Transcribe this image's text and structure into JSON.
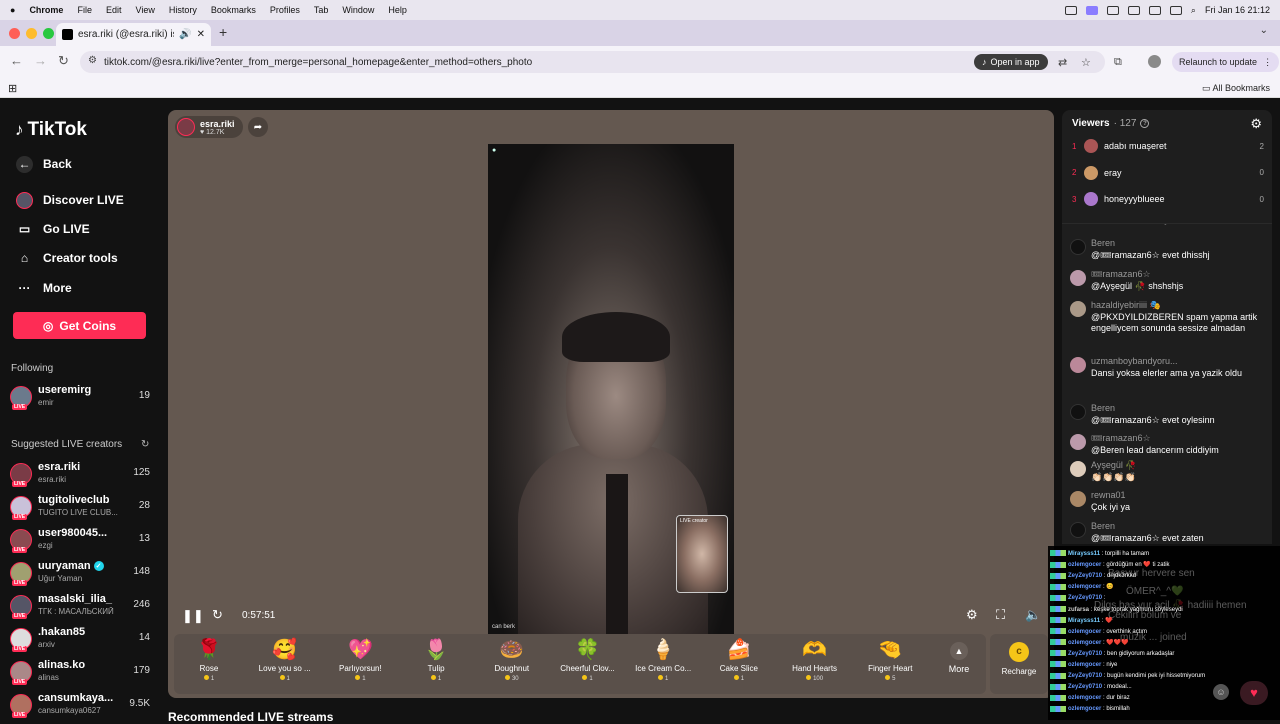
{
  "macbar": {
    "app": "Chrome",
    "menus": [
      "File",
      "Edit",
      "View",
      "History",
      "Bookmarks",
      "Profiles",
      "Tab",
      "Window",
      "Help"
    ],
    "clock": "Fri Jan 16  21:12"
  },
  "browser": {
    "tab_title": "esra.riki (@esra.riki) is LIVE",
    "url": "tiktok.com/@esra.riki/live?enter_from_merge=personal_homepage&enter_method=others_photo",
    "open_in_app": "Open in app",
    "relaunch": "Relaunch to update",
    "all_bookmarks": "All Bookmarks"
  },
  "sidebar": {
    "logo": "TikTok",
    "back": "Back",
    "discover": "Discover LIVE",
    "go_live": "Go LIVE",
    "creator_tools": "Creator tools",
    "more": "More",
    "get_coins": "Get Coins",
    "following_title": "Following",
    "following": [
      {
        "name": "useremirg",
        "sub": "emir",
        "count": "19",
        "color": "#6b7a8c"
      }
    ],
    "suggested_title": "Suggested LIVE creators",
    "suggested": [
      {
        "name": "esra.riki",
        "sub": "esra.riki",
        "count": "125",
        "color": "#7a3b46",
        "verified": false
      },
      {
        "name": "tugitoliveclub",
        "sub": "TUGITO LIVE CLUB...",
        "count": "28",
        "color": "#c9c1d9",
        "verified": false
      },
      {
        "name": "user980045...",
        "sub": "ezgi",
        "count": "13",
        "color": "#8a4a50",
        "verified": false
      },
      {
        "name": "uuryaman",
        "sub": "Uğur Yaman",
        "count": "148",
        "color": "#a0a070",
        "verified": true
      },
      {
        "name": "masalski_ilia_",
        "sub": "ТГК : МАСАЛЬСКИЙ",
        "count": "246",
        "color": "#556",
        "verified": false
      },
      {
        "name": ".hakan85",
        "sub": "arxiv",
        "count": "14",
        "color": "#ddd",
        "verified": false
      },
      {
        "name": "alinas.ko",
        "sub": "alinas",
        "count": "179",
        "color": "#a88",
        "verified": false
      },
      {
        "name": "cansumkaya...",
        "sub": "cansumkaya0627",
        "count": "9.5K",
        "color": "#b07060",
        "verified": false
      }
    ]
  },
  "stream": {
    "host_name": "esra.riki",
    "host_likes": "♥ 12.7K",
    "elapsed": "0:57:51",
    "video_corner": "",
    "video_caption": "can berk",
    "pip_label": "LIVE creator",
    "recommended": "Recommended LIVE streams"
  },
  "gifts": [
    {
      "name": "Rose",
      "price": "1",
      "icon": "🌹"
    },
    {
      "name": "Love you so ...",
      "price": "1",
      "icon": "🥰"
    },
    {
      "name": "Parlıyorsun!",
      "price": "1",
      "icon": "💖"
    },
    {
      "name": "Tulip",
      "price": "1",
      "icon": "🌷"
    },
    {
      "name": "Doughnut",
      "price": "30",
      "icon": "🍩"
    },
    {
      "name": "Cheerful Clov...",
      "price": "1",
      "icon": "🍀"
    },
    {
      "name": "Ice Cream Co...",
      "price": "1",
      "icon": "🍦"
    },
    {
      "name": "Cake Slice",
      "price": "1",
      "icon": "🍰"
    },
    {
      "name": "Hand Hearts",
      "price": "100",
      "icon": "🫶"
    },
    {
      "name": "Finger Heart",
      "price": "5",
      "icon": "🤏"
    }
  ],
  "gift_more": "More",
  "recharge": "Recharge",
  "viewers": {
    "title": "Viewers",
    "count": "· 127",
    "top": [
      {
        "rank": "1",
        "name": "adabı muaşeret",
        "score": "2",
        "color": "#a55"
      },
      {
        "rank": "2",
        "name": "eray",
        "score": "0",
        "color": "#c96"
      },
      {
        "rank": "3",
        "name": "honeyyyblueee",
        "score": "0",
        "color": "#a7c"
      }
    ]
  },
  "chat": [
    {
      "user": "Beren",
      "text": "@🎟ramazan6☆ evet dhisshj",
      "color": "#111"
    },
    {
      "user": "🎟ramazan6☆",
      "text": "@Ayşegül 🥀 shshshjs",
      "color": "#b9a"
    },
    {
      "user": "hazaldiyebiriiii 🎭",
      "text": "@PKXDYILDIZBEREN spam yapma artik engelliycem sonunda sessize almadan",
      "color": "#a98"
    },
    {
      "user": "uzmanboybandyoru...",
      "text": "Dansi yoksa elerler ama ya yazik oldu",
      "color": "#b89"
    },
    {
      "user": "Beren",
      "text": "@🎟ramazan6☆ evet oylesinn",
      "color": "#111"
    },
    {
      "user": "🎟ramazan6☆",
      "text": "@Beren lead dancerım ciddiyim",
      "color": "#b9a"
    },
    {
      "user": "Ayşegül 🥀",
      "text": "👏🏻👏🏻👏🏻👏🏻",
      "color": "#dcb"
    },
    {
      "user": "rewna01",
      "text": "Çok iyi ya",
      "color": "#a86"
    },
    {
      "user": "Beren",
      "text": "@🎟ramazan6☆ evet zaten",
      "color": "#111"
    }
  ],
  "overlay_lines": [
    {
      "user": "Miraysss11",
      "text": "torpilli ha tamam",
      "color": "#7cf"
    },
    {
      "user": "ozlemgocer",
      "text": "gördüğüm en ❤️ ti zatik",
      "color": "#69f"
    },
    {
      "user": "ZeyZey0710",
      "text": "dnjdk3rkkd",
      "color": "#69f"
    },
    {
      "user": "ozlemgocer",
      "text": "😊",
      "color": "#69f"
    },
    {
      "user": "ZeyZey0710",
      "text": "",
      "color": "#69f"
    },
    {
      "user": "zufarsa",
      "text": "keşke toprak yağmuru söyleseydi",
      "color": "#ccc"
    },
    {
      "user": "Miraysss11",
      "text": "❤️",
      "color": "#7cf"
    },
    {
      "user": "ozlemgocer",
      "text": "overthink açtım",
      "color": "#69f"
    },
    {
      "user": "ozlemgocer",
      "text": "❤️❤️❤️",
      "color": "#69f"
    },
    {
      "user": "ZeyZey0710",
      "text": "ben gidiyorum arkadaşlar",
      "color": "#69f"
    },
    {
      "user": "ozlemgocer",
      "text": "niye",
      "color": "#69f"
    },
    {
      "user": "ZeyZey0710",
      "text": "bugün kendimi pek iyi hissetmiyorum",
      "color": "#69f"
    },
    {
      "user": "ZeyZey0710",
      "text": "modeal...",
      "color": "#69f"
    },
    {
      "user": "ozlemgocer",
      "text": "dur biraz",
      "color": "#69f"
    },
    {
      "user": "ozlemgocer",
      "text": "bismillah",
      "color": "#69f"
    }
  ],
  "ghost_texts": [
    "Basvur hervere sen",
    "ÖMER^_^💚",
    "Dilgs baş vur acil 🥀 hadiiii hemen",
    "Çekilin bölüm ve",
    "müzik ... joined"
  ]
}
